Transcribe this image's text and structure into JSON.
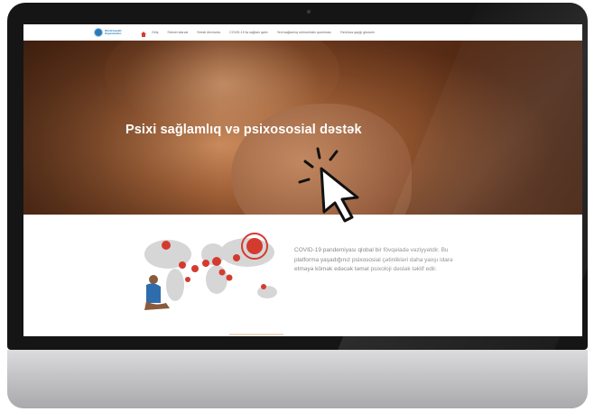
{
  "logo": {
    "text": "World Health\nOrganization",
    "emblem_icon": "who-emblem-icon"
  },
  "nav": {
    "home_icon": "home-icon",
    "items": [
      {
        "label": "Giriş"
      },
      {
        "label": "Stresin idarəsi"
      },
      {
        "label": "Stresli dövrlərdə"
      },
      {
        "label": "COVID-19 ilə sağlam qalın"
      },
      {
        "label": "Yeni sağlamlıq rutinlərinizin qurulması"
      },
      {
        "label": "Özünüzə qayğı göstərin"
      }
    ]
  },
  "hero": {
    "title": "Psixi sağlamlıq və psixososial dəstək"
  },
  "intro": {
    "text": "COVID-19 pandemiyası qlobal bir fövqəladə vəziyyətdir. Bu platforma yaşadığınız psixososial çətinlikləri daha yaxşı idarə etməyə kömək edəcək təməl psixoloji dəstək təklif edir."
  },
  "colors": {
    "accent_red": "#d43b2f",
    "logo_blue": "#2a7ab8"
  }
}
